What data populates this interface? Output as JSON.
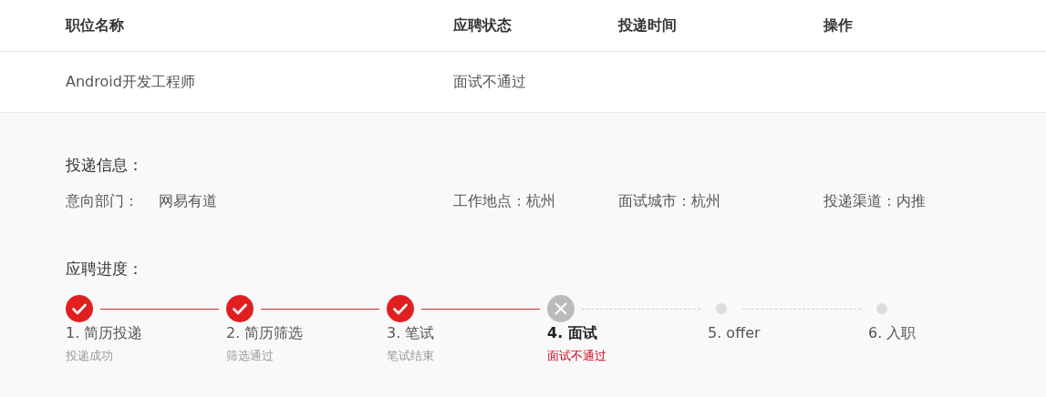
{
  "table": {
    "columns": [
      "职位名称",
      "应聘状态",
      "投递时间",
      "操作"
    ],
    "rows": [
      {
        "cells": [
          "Android开发工程师",
          "面试不通过",
          "",
          ""
        ]
      }
    ]
  },
  "details": {
    "title": "投递信息：",
    "fields": [
      {
        "label": "意向部门：",
        "value": "网易有道"
      },
      {
        "label": "工作地点：",
        "value": "杭州"
      },
      {
        "label": "面试城市：",
        "value": "杭州"
      },
      {
        "label": "投递渠道：",
        "value": "内推"
      }
    ]
  },
  "progress": {
    "title": "应聘进度：",
    "steps": [
      {
        "kind": "done",
        "label": "1. 简历投递",
        "note": "投递成功"
      },
      {
        "kind": "done",
        "label": "2. 简历筛选",
        "note": "筛选通过"
      },
      {
        "kind": "done",
        "label": "3. 笔试",
        "note": "笔试结束"
      },
      {
        "kind": "failed",
        "label": "4. 面试",
        "note": "面试不通过"
      },
      {
        "kind": "pending",
        "label": "5. offer"
      },
      {
        "kind": "pending",
        "label": "6. 入职"
      }
    ]
  }
}
